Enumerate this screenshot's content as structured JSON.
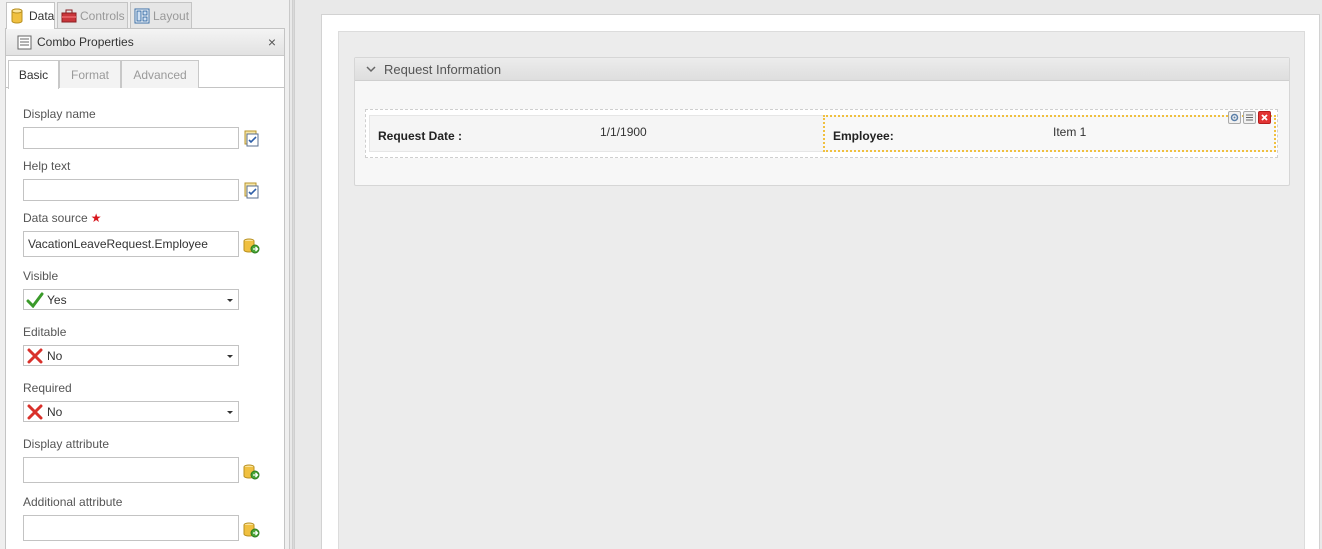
{
  "top_tabs": [
    {
      "label": "Data",
      "icon": "database-icon",
      "active": true
    },
    {
      "label": "Controls",
      "icon": "toolbox-icon",
      "active": false
    },
    {
      "label": "Layout",
      "icon": "layout-icon",
      "active": false
    }
  ],
  "properties_panel": {
    "title": "Combo Properties",
    "close_label": "×",
    "tabs": [
      {
        "label": "Basic",
        "active": true
      },
      {
        "label": "Format",
        "active": false
      },
      {
        "label": "Advanced",
        "active": false
      }
    ],
    "fields": {
      "display_name": {
        "label": "Display name",
        "value": ""
      },
      "help_text": {
        "label": "Help text",
        "value": ""
      },
      "data_source": {
        "label": "Data source",
        "required_marker": "★",
        "value": "VacationLeaveRequest.Employee"
      },
      "visible": {
        "label": "Visible",
        "value": "Yes",
        "icon": "check-icon"
      },
      "editable": {
        "label": "Editable",
        "value": "No",
        "icon": "cross-icon"
      },
      "required": {
        "label": "Required",
        "value": "No",
        "icon": "cross-icon"
      },
      "display_attribute": {
        "label": "Display attribute",
        "value": ""
      },
      "additional_attribute": {
        "label": "Additional attribute",
        "value": ""
      }
    }
  },
  "canvas": {
    "section": {
      "title": "Request Information",
      "left_cell": {
        "label": "Request Date :",
        "value": "1/1/1900"
      },
      "right_cell": {
        "label": "Employee:",
        "value": "Item 1"
      }
    }
  },
  "colors": {
    "selection_outline": "#f0c040",
    "delete_red": "#e23434",
    "required_star": "#d8161d",
    "check_green": "#3a9a2a"
  }
}
